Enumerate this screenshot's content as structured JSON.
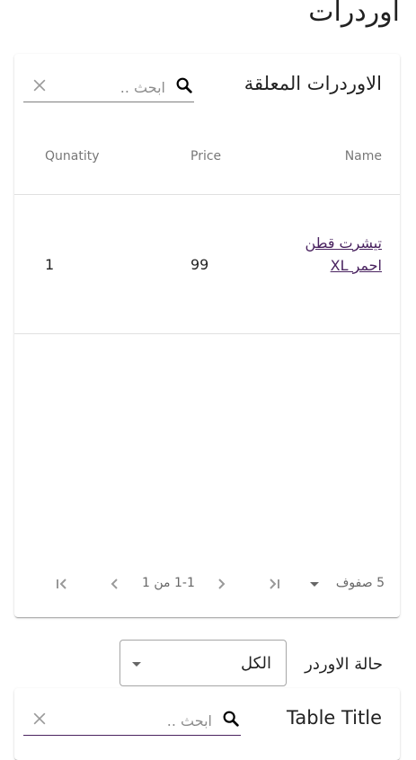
{
  "page": {
    "title": "اوردرات"
  },
  "pending_table": {
    "title": "الاوردرات المعلقة",
    "search": {
      "placeholder": "ابحث ..",
      "value": ""
    },
    "columns": {
      "name": "Name",
      "price": "Price",
      "quantity": "Qunatity"
    },
    "rows": [
      {
        "name": "تيشرت قطن احمر XL",
        "price": "99",
        "quantity": "1"
      }
    ],
    "pagination": {
      "rows_per_page": "5 صفوف",
      "range": "1-1 من 1"
    }
  },
  "order_status": {
    "label": "حالة الاوردر",
    "selected": "الكل"
  },
  "second_table": {
    "title": "Table Title",
    "search": {
      "placeholder": "ابحث ..",
      "value": ""
    }
  },
  "colors": {
    "accent": "#4a2360",
    "divider": "#e0e0e0"
  }
}
